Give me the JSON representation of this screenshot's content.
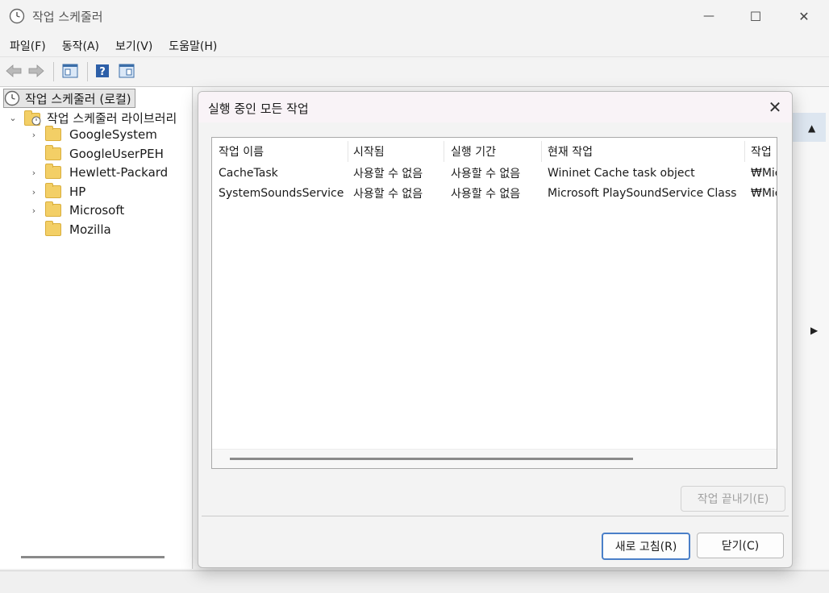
{
  "window": {
    "title": "작업 스케줄러",
    "minimize_glyph": "—",
    "maximize_glyph": "☐",
    "close_glyph": "✕"
  },
  "menu": [
    {
      "label": "파일(F)"
    },
    {
      "label": "동작(A)"
    },
    {
      "label": "보기(V)"
    },
    {
      "label": "도움말(H)"
    }
  ],
  "tree": {
    "root": "작업 스케줄러 (로컬)",
    "library": "작업 스케줄러 라이브러리",
    "folders": [
      {
        "label": "GoogleSystem",
        "expandable": true
      },
      {
        "label": "GoogleUserPEH",
        "expandable": false
      },
      {
        "label": "Hewlett-Packard",
        "expandable": true
      },
      {
        "label": "HP",
        "expandable": true
      },
      {
        "label": "Microsoft",
        "expandable": true
      },
      {
        "label": "Mozilla",
        "expandable": false
      }
    ]
  },
  "dialog": {
    "title": "실행 중인 모든 작업",
    "columns": [
      "작업 이름",
      "시작됨",
      "실행 기간",
      "현재 작업",
      "작업"
    ],
    "rows": [
      [
        "CacheTask",
        "사용할 수 없음",
        "사용할 수 없음",
        "Wininet Cache task object",
        "₩Mic"
      ],
      [
        "SystemSoundsService",
        "사용할 수 없음",
        "사용할 수 없음",
        "Microsoft PlaySoundService Class",
        "₩Mic"
      ]
    ],
    "end_task_label": "작업 끝내기(E)",
    "refresh_label": "새로 고침(R)",
    "close_label": "닫기(C)"
  },
  "colors": {
    "accent": "#4a7fc8",
    "folder": "#f3cf66"
  }
}
